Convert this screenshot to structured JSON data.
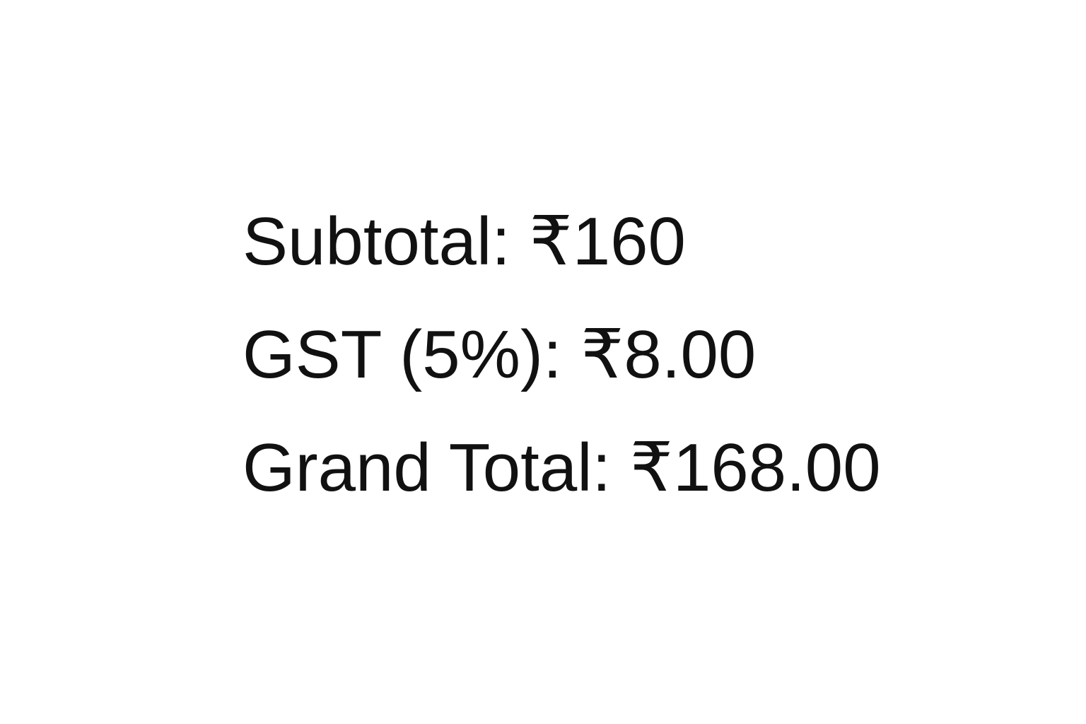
{
  "totals": {
    "subtotal_line": "Subtotal: ₹160",
    "gst_line": "GST (5%): ₹8.00",
    "grand_total_line": "Grand Total: ₹168.00"
  }
}
